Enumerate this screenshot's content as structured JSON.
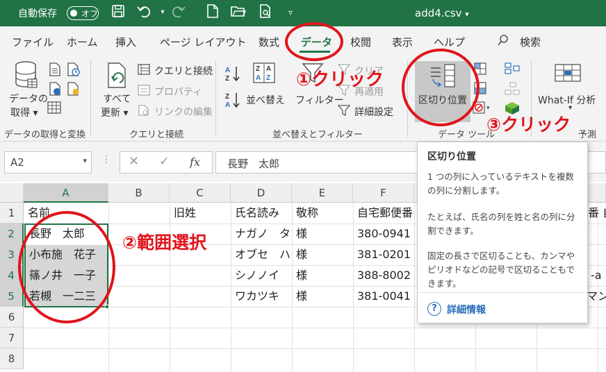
{
  "titlebar": {
    "autosave_label": "自動保存",
    "autosave_state": "オフ",
    "filename": "add4.csv"
  },
  "tabs": [
    {
      "label": "ファイル"
    },
    {
      "label": "ホーム"
    },
    {
      "label": "挿入"
    },
    {
      "label": "ページ レイアウト"
    },
    {
      "label": "数式"
    },
    {
      "label": "データ",
      "active": true
    },
    {
      "label": "校閲"
    },
    {
      "label": "表示"
    },
    {
      "label": "ヘルプ"
    }
  ],
  "search_label": "検索",
  "ribbon": {
    "get_data": {
      "line1": "データの",
      "line2": "取得 ▾",
      "group": "データの取得と変換"
    },
    "queries": {
      "refresh_line1": "すべて",
      "refresh_line2": "更新 ▾",
      "connections": "クエリと接続",
      "properties": "プロパティ",
      "edit_links": "リンクの編集",
      "group": "クエリと接続"
    },
    "sort": {
      "sort_label": "並べ替え",
      "filter_label": "フィルター",
      "clear": "クリア",
      "reapply": "再適用",
      "advanced": "詳細設定",
      "group": "並べ替えとフィルター"
    },
    "tools": {
      "text_to_columns": "区切り位置",
      "group": "データ ツール"
    },
    "whatif": {
      "label": "What-If 分析",
      "arrow": "▾"
    },
    "forecast_group": "予測"
  },
  "formula_bar": {
    "name_box": "A2",
    "cancel_icon": "✕",
    "enter_icon": "✓",
    "fx": "fx",
    "value": "長野　太郎"
  },
  "columns": [
    "A",
    "B",
    "C",
    "D",
    "E",
    "F"
  ],
  "rows": [
    "1",
    "2",
    "3",
    "4",
    "5",
    "6",
    "7",
    "8"
  ],
  "cells": {
    "A1": "名前",
    "C1": "旧姓",
    "D1": "氏名読み",
    "E1": "敬称",
    "F1": "自宅郵便番",
    "A2": "長野　太郎",
    "D2": "ナガノ　タ",
    "E2": "様",
    "F2": "380-0941",
    "A3": "小布施　花子",
    "D3": "オブセ　ハ",
    "E3": "様",
    "F3": "381-0201",
    "A4": "篠ノ井　一子",
    "D4": "シノノイ",
    "E4": "様",
    "F4": "388-8002",
    "A5": "若槻　一二三",
    "D5": "ワカツキ",
    "E5": "様",
    "F5": "381-0041",
    "R1": "番 自",
    "R4": "-a",
    "R5": "マン"
  },
  "tooltip": {
    "title": "区切り位置",
    "p1": "1 つの列に入っているテキストを複数の列に分割します。",
    "p2": "たとえば、氏名の列を姓と名の列に分割できます。",
    "p3": "固定の長さで区切ることも、カンマやピリオドなどの記号で区切ることもできます。",
    "help_icon": "?",
    "link": "詳細情報"
  },
  "annotations": {
    "step1": "①クリック",
    "step2": "②範囲選択",
    "step3": "③クリック",
    "color": "#e0141b"
  },
  "colors": {
    "excel_green": "#217346",
    "tooltip_link": "#2a6ebb"
  }
}
